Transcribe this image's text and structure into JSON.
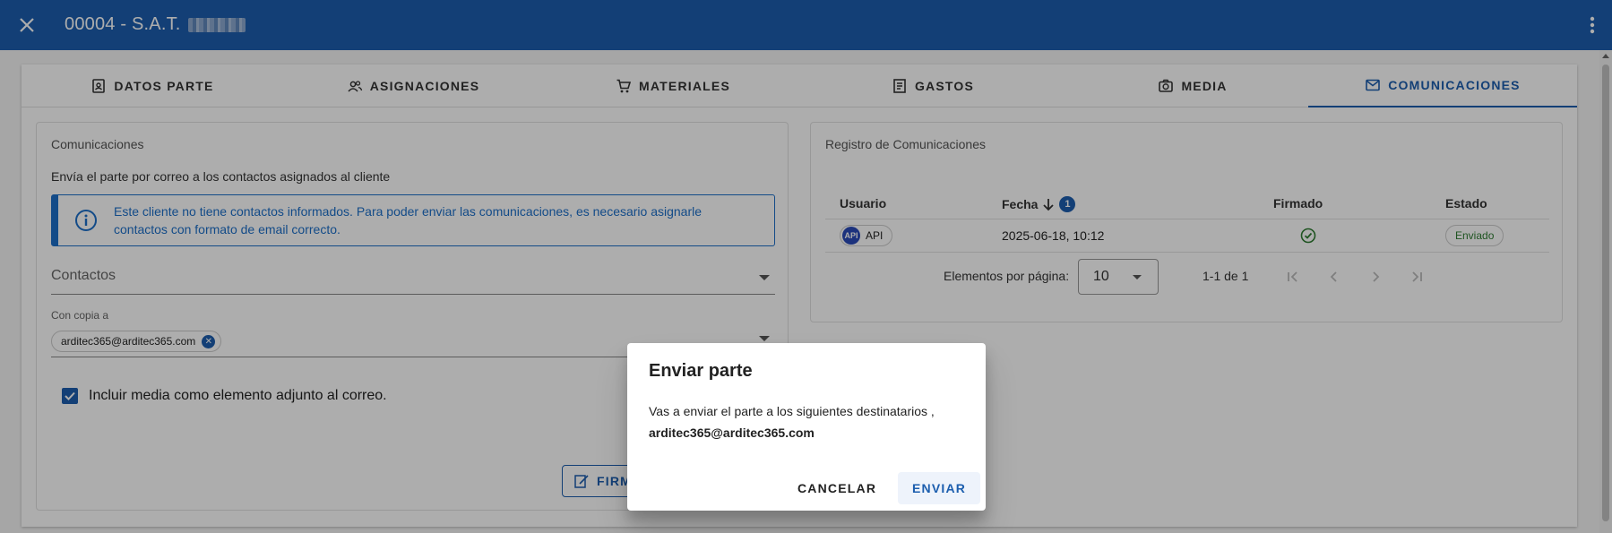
{
  "header": {
    "title": "00004 - S.A.T.",
    "close_icon": "close-icon",
    "menu_icon": "more-vert-icon",
    "bg_color": "#1c5eae"
  },
  "tabs": [
    {
      "label": "DATOS PARTE",
      "icon": "contact-card-icon"
    },
    {
      "label": "ASIGNACIONES",
      "icon": "people-icon"
    },
    {
      "label": "MATERIALES",
      "icon": "cart-icon"
    },
    {
      "label": "GASTOS",
      "icon": "receipt-icon"
    },
    {
      "label": "MEDIA",
      "icon": "camera-icon"
    },
    {
      "label": "COMUNICACIONES",
      "icon": "mail-icon",
      "active": true
    }
  ],
  "comms": {
    "title": "Comunicaciones",
    "description": "Envía el parte por correo a los contactos asignados al cliente",
    "alert": "Este cliente no tiene contactos informados. Para poder enviar las comunicaciones, es necesario asignarle contactos con formato de email correcto.",
    "contacts_label": "Contactos",
    "cc_label": "Con copia a",
    "cc_chip": "arditec365@arditec365.com",
    "checkbox_label": "Incluir media como elemento adjunto al correo.",
    "checkbox_checked": true,
    "sign_button": "FIRMAR Y ENVIAR"
  },
  "registry": {
    "title": "Registro de Comunicaciones",
    "columns": {
      "user": "Usuario",
      "date": "Fecha",
      "sort_index": "1",
      "signed": "Firmado",
      "status": "Estado"
    },
    "rows": [
      {
        "avatar": "API",
        "user": "API",
        "date": "2025-06-18, 10:12",
        "signed": true,
        "status": "Enviado"
      }
    ],
    "pager": {
      "label": "Elementos por página:",
      "page_size": "10",
      "range": "1-1 de 1"
    }
  },
  "dialog": {
    "title": "Enviar parte",
    "body": "Vas a enviar el parte a los siguientes destinatarios ,",
    "recipient": "arditec365@arditec365.com",
    "cancel": "CANCELAR",
    "send": "ENVIAR"
  }
}
